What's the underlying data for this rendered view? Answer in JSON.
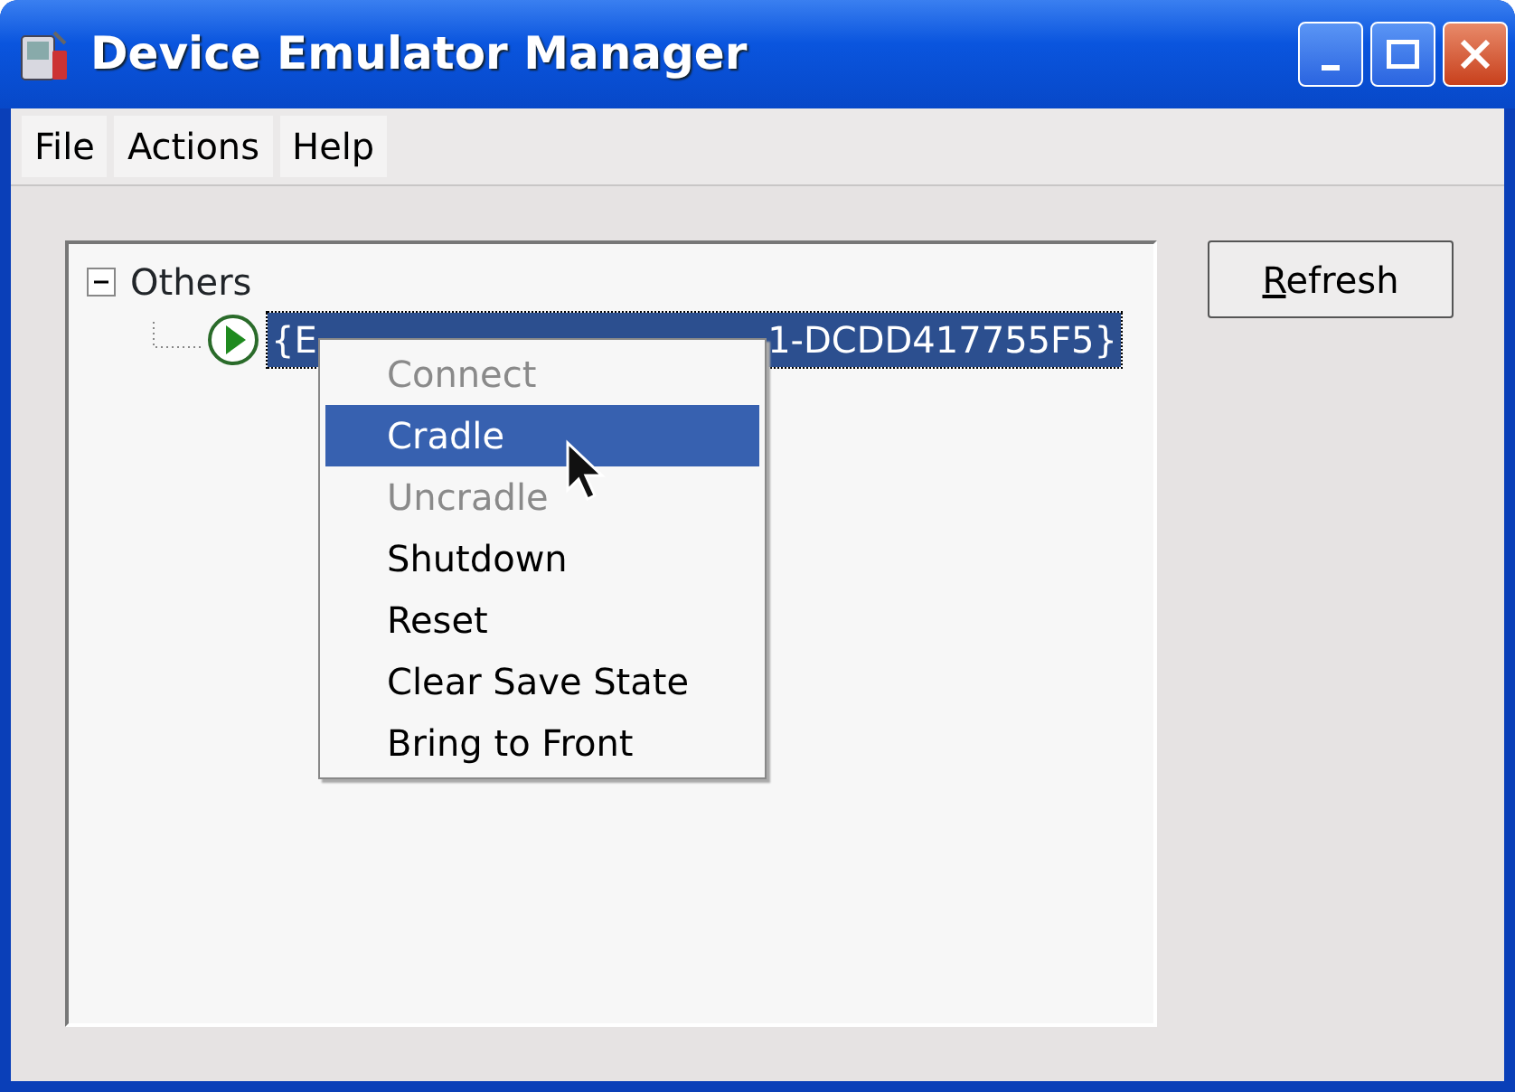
{
  "window": {
    "title": "Device Emulator Manager"
  },
  "menu_bar": [
    {
      "label": "File"
    },
    {
      "label": "Actions"
    },
    {
      "label": "Help"
    }
  ],
  "tree": [
    {
      "label": "Others",
      "expanded": true,
      "children": [
        {
          "label_start": "{E",
          "label_end": "1-DCDD417755F5}",
          "selected": true,
          "running": true
        }
      ]
    }
  ],
  "refresh_button": {
    "mnemonic": "R",
    "label_rest": "efresh"
  },
  "context_menu": [
    {
      "label": "Connect",
      "disabled": true,
      "selected": false
    },
    {
      "label": "Cradle",
      "disabled": false,
      "selected": true
    },
    {
      "label": "Uncradle",
      "disabled": true,
      "selected": false
    },
    {
      "label": "Shutdown",
      "disabled": false,
      "selected": false
    },
    {
      "label": "Reset",
      "disabled": false,
      "selected": false
    },
    {
      "label": "Clear Save State",
      "disabled": false,
      "selected": false
    },
    {
      "label": "Bring to Front",
      "disabled": false,
      "selected": false
    }
  ]
}
